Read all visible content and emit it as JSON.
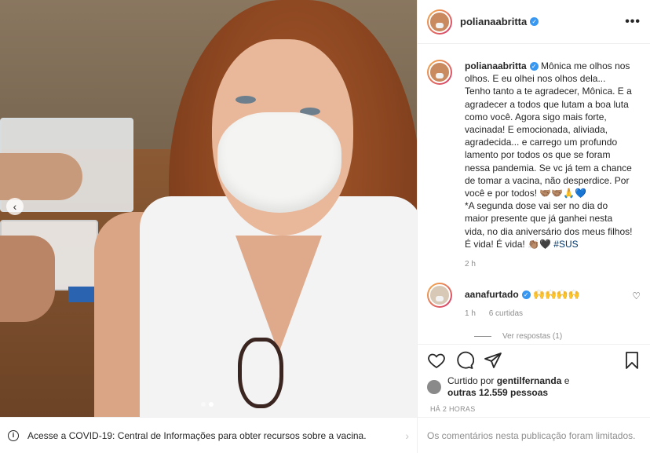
{
  "post": {
    "username": "polianaabritta",
    "more_label": "•••"
  },
  "caption": {
    "username": "polianaabritta",
    "text": "Mônica me olhos nos olhos. E eu olhei nos olhos dela... Tenho tanto a te agradecer, Mônica. E a agradecer a todos que lutam a boa luta como você. Agora sigo mais forte, vacinada! E emocionada, aliviada, agradecida... e carrego um profundo lamento por todos os que se foram nessa pandemia. Se vc já tem a chance de tomar a vacina, não desperdice. Por você e por todos! 🤝🏽🤝🏽🙏💙\n*A segunda dose vai ser no dia do maior presente que já ganhei nesta vida, no dia aniversário dos meus filhos! É vida! É vida! 👏🏽🖤 ",
    "hashtag": "#SUS",
    "time": "2 h"
  },
  "comment": {
    "username": "aanafurtado",
    "text": "🙌🙌🙌🙌",
    "time": "1 h",
    "likes": "6 curtidas",
    "replies": "Ver respostas (1)"
  },
  "likes": {
    "prefix": "Curtido por ",
    "user": "gentilfernanda",
    "middle": " e",
    "others": "outras 12.559 pessoas"
  },
  "timestamp": "HÁ 2 HORAS",
  "covid_banner": "Acesse a COVID-19: Central de Informações para obter recursos sobre a vacina.",
  "comments_limited": "Os comentários nesta publicação foram limitados."
}
